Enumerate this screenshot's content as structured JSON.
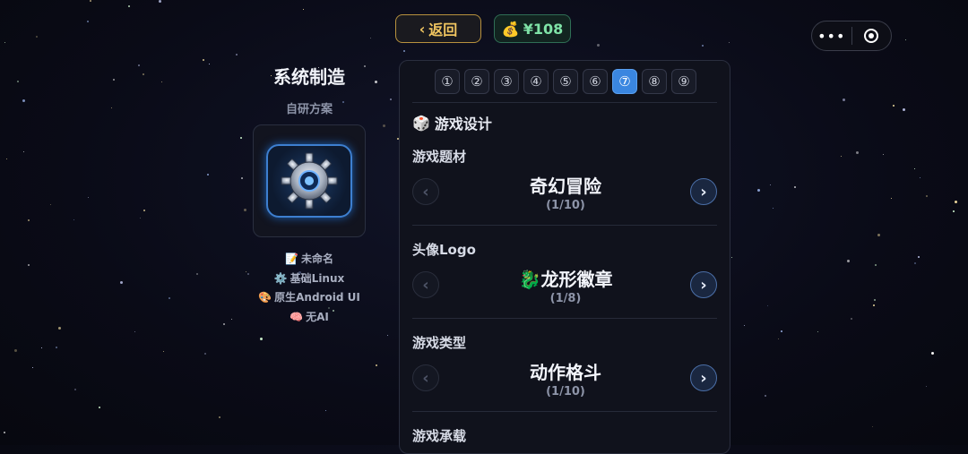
{
  "header": {
    "back_label": "返回",
    "back_chevron": "‹",
    "money_icon": "💰",
    "money_value": "¥108",
    "capsule_dots": "•••"
  },
  "system": {
    "title": "系统制造",
    "subtitle": "自研方案",
    "meta": [
      {
        "icon": "📝",
        "text": "未命名"
      },
      {
        "icon": "⚙️",
        "text": "基础Linux"
      },
      {
        "icon": "🎨",
        "text": "原生Android UI"
      },
      {
        "icon": "🧠",
        "text": "无AI"
      }
    ]
  },
  "steps": [
    "①",
    "②",
    "③",
    "④",
    "⑤",
    "⑥",
    "⑦",
    "⑧",
    "⑨"
  ],
  "active_step": 7,
  "section": {
    "icon": "🎲",
    "title": "游戏设计"
  },
  "fields": [
    {
      "label": "游戏题材",
      "icon": "",
      "value": "奇幻冒险",
      "count": "(1/10)"
    },
    {
      "label": "头像Logo",
      "icon": "🐉",
      "value": "龙形徽章",
      "count": "(1/8)"
    },
    {
      "label": "游戏类型",
      "icon": "",
      "value": "动作格斗",
      "count": "(1/10)"
    },
    {
      "label": "游戏承载",
      "icon": "",
      "value": "",
      "count": ""
    }
  ],
  "arrows": {
    "prev": "‹",
    "next": "›"
  },
  "colors": {
    "accent": "#3a86e0",
    "gold": "#f0c560",
    "money": "#7fe3a7"
  }
}
